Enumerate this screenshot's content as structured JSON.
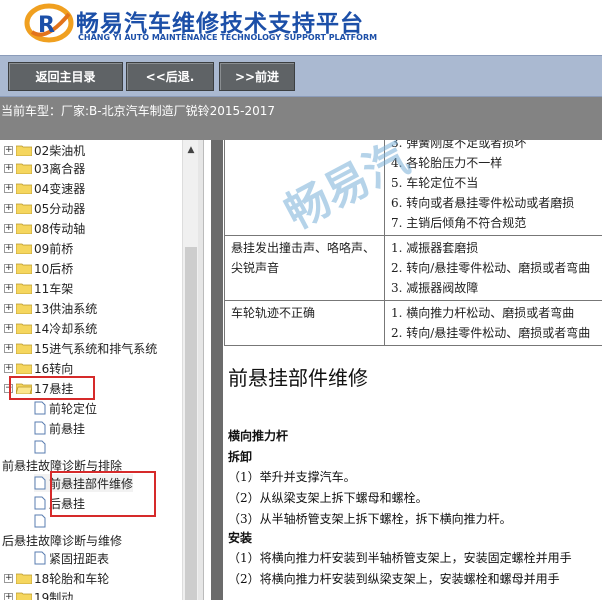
{
  "header": {
    "title": "畅易汽车维修技术支持平台",
    "subtitle": "CHANG YI AUTO MAINTENANCE TECHNOLOGY SUPPORT PLATFORM",
    "logo_letter": "R"
  },
  "toolbar": {
    "home": "返回主目录",
    "back": "<<后退.",
    "forward": ">>前进"
  },
  "car": {
    "label": "当前车型：",
    "value": "厂家:B-北京汽车制造厂锐铃2015-2017"
  },
  "tree": {
    "items": [
      "02柴油机",
      "03离合器",
      "04变速器",
      "05分动器",
      "08传动轴",
      "09前桥",
      "10后桥",
      "11车架",
      "13供油系统",
      "14冷却系统",
      "15进气系统和排气系统",
      "16转向",
      "17悬挂"
    ],
    "sub_a": [
      "前轮定位",
      "前悬挂"
    ],
    "group1": "前悬挂故障诊断与排除",
    "sub_b": [
      "前悬挂部件维修",
      "后悬挂"
    ],
    "group2": "后悬挂故障诊断与维修",
    "sub_c": "紧固扭距表",
    "items2": [
      "18轮胎和车轮",
      "19制动"
    ]
  },
  "content": {
    "watermark": "畅易汽",
    "table": [
      {
        "symptom": "",
        "causes": [
          "3. 弹簧刚度不足或者损坏",
          "4. 各轮胎压力不一样",
          "5. 车轮定位不当",
          "6. 转向或者悬挂零件松动或者磨损",
          "7. 主销后倾角不符合规范"
        ]
      },
      {
        "symptom": "悬挂发出撞击声、咯咯声、尖锐声音",
        "causes": [
          "1. 减振器套磨损",
          "2. 转向/悬挂零件松动、磨损或者弯曲",
          "3. 减振器阀故障"
        ]
      },
      {
        "symptom": "车轮轨迹不正确",
        "causes": [
          "1. 横向推力杆松动、磨损或者弯曲",
          "2. 转向/悬挂零件松动、磨损或者弯曲"
        ]
      }
    ],
    "heading": "前悬挂部件维修",
    "sub1": "横向推力杆",
    "sub2": "拆卸",
    "remove": [
      "（1）举升并支撑汽车。",
      "（2）从纵梁支架上拆下螺母和螺栓。",
      "（3）从半轴桥管支架上拆下螺栓，拆下横向推力杆。"
    ],
    "sub3": "安装",
    "install": [
      "（1）将横向推力杆安装到半轴桥管支架上，安装固定螺栓并用手",
      "（2）将横向推力杆安装到纵梁支架上，安装螺栓和螺母并用手"
    ]
  }
}
